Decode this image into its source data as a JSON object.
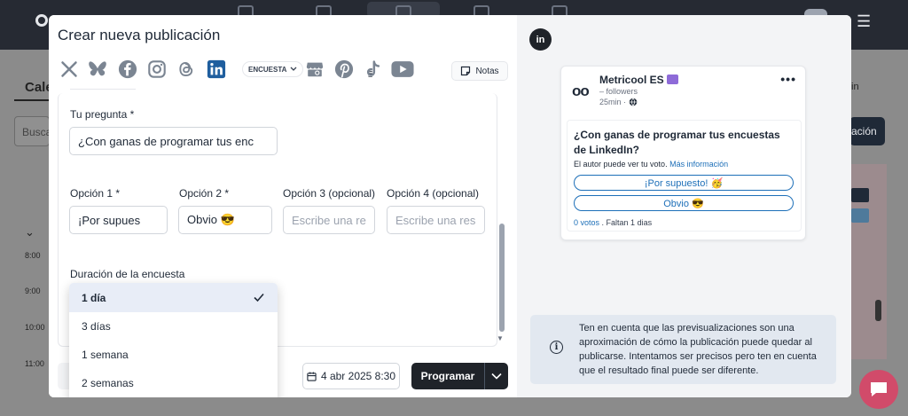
{
  "background": {
    "tab_label": "Cale",
    "search_placeholder": "Busca",
    "times": [
      "8:00",
      "9:00",
      "10:00",
      "11:00"
    ],
    "right_button_label": "ación",
    "right_select_label": "in"
  },
  "modal": {
    "title": "Crear nueva publicación",
    "networks": [
      {
        "icon": "x-icon"
      },
      {
        "icon": "bluesky-icon"
      },
      {
        "icon": "facebook-icon"
      },
      {
        "icon": "instagram-icon"
      },
      {
        "icon": "threads-icon"
      },
      {
        "icon": "linkedin-icon",
        "active": true
      },
      {
        "icon": "google-business-icon"
      },
      {
        "icon": "pinterest-icon"
      },
      {
        "icon": "tiktok-icon"
      },
      {
        "icon": "youtube-icon"
      }
    ],
    "post_type": "ENCUESTA",
    "notes_label": "Notas",
    "question_label": "Tu pregunta *",
    "question_value": "¿Con ganas de programar tus enc",
    "options": [
      {
        "label": "Opción 1 *",
        "value": "¡Por supues",
        "placeholder": ""
      },
      {
        "label": "Opción 2 *",
        "value": "Obvio 😎",
        "placeholder": ""
      },
      {
        "label": "Opción 3 (opcional)",
        "value": "",
        "placeholder": "Escribe una re"
      },
      {
        "label": "Opción 4 (opcional)",
        "value": "",
        "placeholder": "Escribe una res"
      }
    ],
    "duration_label": "Duración de la encuesta",
    "duration_options": [
      "1 día",
      "3 días",
      "1 semana",
      "2 semanas"
    ],
    "duration_selected": "1 día",
    "date_label": "4 abr 2025 8:30",
    "schedule_label": "Programar"
  },
  "preview": {
    "network_badge": "in",
    "account_name": "Metricool ES",
    "followers": "– followers",
    "time": "25min ·",
    "question": "¿Con ganas de programar tus encuestas de LinkedIn?",
    "note_prefix": "El autor puede ver tu voto.",
    "note_link": "Más información",
    "options": [
      "¡Por supuesto! 🥳",
      "Obvio 😎"
    ],
    "votes": "0 votos",
    "remaining": ". Faltan 1 dias",
    "info": "Ten en cuenta que las previsualizaciones son una aproximación de cómo la publicación puede quedar al publicarse. Intentamos ser precisos pero ten en cuenta que el resultado final puede ser diferente."
  },
  "colors": {
    "accent_link": "#1d6fb8",
    "primary_button": "#1f2329",
    "selected_option_bg": "#e8edf7",
    "chat_bubble": "#d14b6a"
  }
}
